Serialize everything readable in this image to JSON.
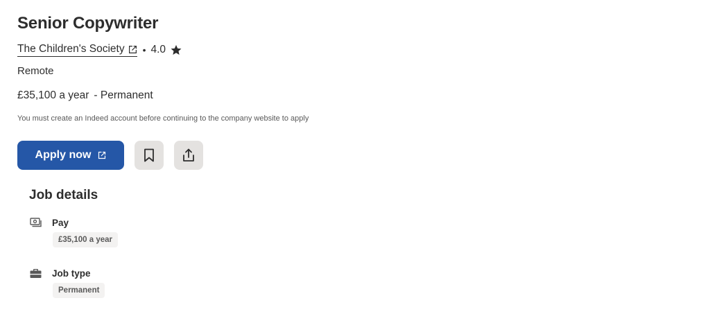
{
  "job": {
    "title": "Senior Copywriter",
    "company": "The Children's Society",
    "separator": "•",
    "rating": "4.0",
    "location": "Remote",
    "salary": "£35,100 a year",
    "salary_separator": "- Permanent",
    "notice": "You must create an Indeed account before continuing to the company website to apply"
  },
  "actions": {
    "apply_label": "Apply now",
    "save_icon": "bookmark-icon",
    "share_icon": "share-icon"
  },
  "details": {
    "heading": "Job details",
    "items": [
      {
        "label": "Pay",
        "value": "£35,100 a year",
        "icon": "money-icon"
      },
      {
        "label": "Job type",
        "value": "Permanent",
        "icon": "briefcase-icon"
      }
    ]
  },
  "colors": {
    "primary": "#2557a7",
    "text": "#2d2d2d",
    "muted": "#595959",
    "button_bg": "#e4e2e0",
    "tag_bg": "#f3f2f1"
  }
}
